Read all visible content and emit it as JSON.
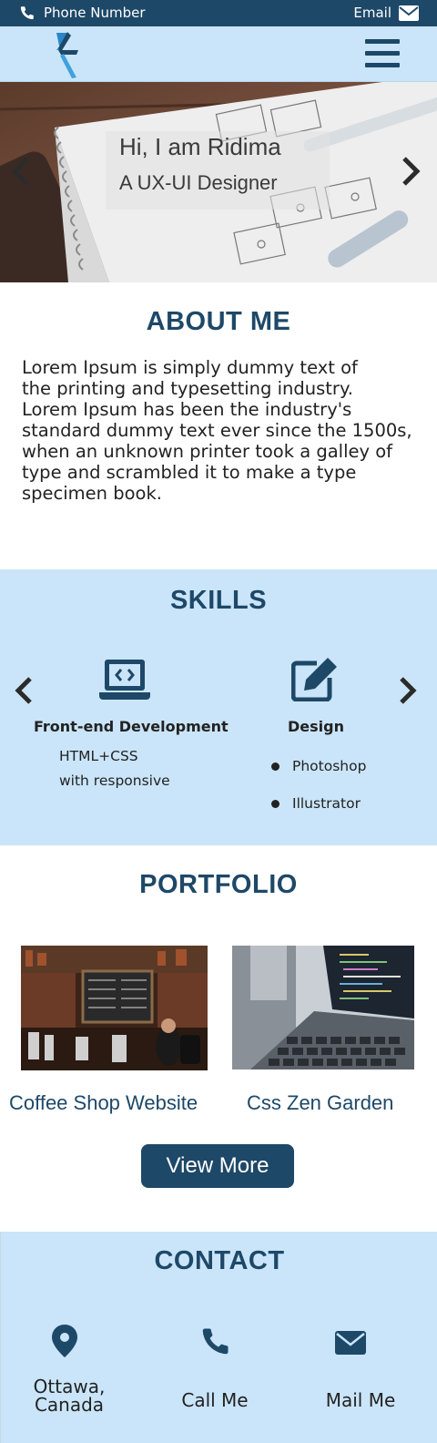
{
  "topbar": {
    "phone_icon": "phone-icon",
    "phone_label": "Phone Number",
    "email_label": "Email",
    "email_icon": "envelope-icon"
  },
  "header": {
    "logo_icon": "logo-chevron-icon",
    "menu_icon": "hamburger-menu-icon"
  },
  "hero": {
    "title": "Hi, I am Ridima",
    "subtitle": "A UX-UI Designer",
    "prev_icon": "chevron-left-icon",
    "next_icon": "chevron-right-icon"
  },
  "about": {
    "heading": "ABOUT ME",
    "lines": [
      "Lorem Ipsum is simply dummy text of",
      "the printing and typesetting industry.",
      "Lorem Ipsum has been the industry's",
      "standard dummy text ever since the 1500s,",
      "when an unknown printer took a galley of",
      "type and scrambled it to make a type",
      "specimen book."
    ]
  },
  "skills": {
    "heading": "SKILLS",
    "items": [
      {
        "icon": "laptop-code-icon",
        "name": "Front-end Development",
        "desc": [
          "HTML+CSS",
          "with responsive"
        ]
      },
      {
        "icon": "edit-icon",
        "name": "Design",
        "bullets": [
          "Photoshop",
          "Illustrator"
        ]
      }
    ]
  },
  "portfolio": {
    "heading": "PORTFOLIO",
    "items": [
      {
        "caption": "Coffee Shop Website"
      },
      {
        "caption": "Css Zen Garden"
      }
    ],
    "view_more": "View More"
  },
  "contact": {
    "heading": "CONTACT",
    "items": [
      {
        "icon": "map-marker-icon",
        "label_lines": [
          "Ottawa,",
          "Canada"
        ]
      },
      {
        "icon": "phone-icon",
        "label_lines": [
          "Call Me"
        ]
      },
      {
        "icon": "envelope-icon",
        "label_lines": [
          "Mail Me"
        ]
      }
    ]
  },
  "colors": {
    "primary": "#1e4868",
    "light": "#cae5f9"
  }
}
